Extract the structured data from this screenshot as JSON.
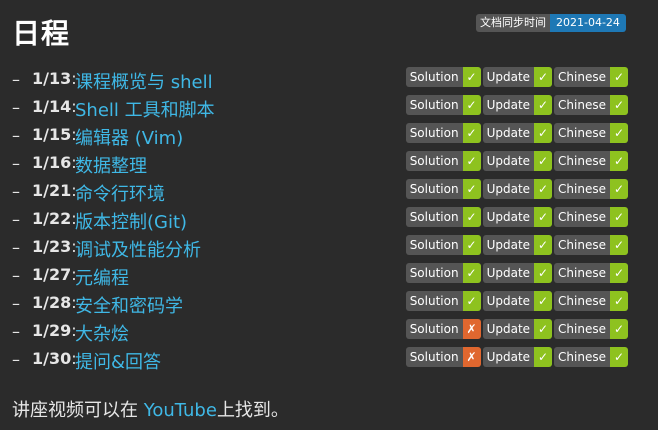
{
  "page": {
    "title": "日程",
    "sync_label": "文档同步时间",
    "sync_date": "2021-04-24"
  },
  "dash": "–",
  "colon": ":",
  "schedule": [
    {
      "date": "1/13",
      "topic": "课程概览与 shell",
      "badges": [
        {
          "label": "Solution",
          "mark": "✓",
          "ok": true
        },
        {
          "label": "Update",
          "mark": "✓",
          "ok": true
        },
        {
          "label": "Chinese",
          "mark": "✓",
          "ok": true
        }
      ]
    },
    {
      "date": "1/14",
      "topic": "Shell 工具和脚本",
      "badges": [
        {
          "label": "Solution",
          "mark": "✓",
          "ok": true
        },
        {
          "label": "Update",
          "mark": "✓",
          "ok": true
        },
        {
          "label": "Chinese",
          "mark": "✓",
          "ok": true
        }
      ]
    },
    {
      "date": "1/15",
      "topic": "编辑器 (Vim)",
      "badges": [
        {
          "label": "Solution",
          "mark": "✓",
          "ok": true
        },
        {
          "label": "Update",
          "mark": "✓",
          "ok": true
        },
        {
          "label": "Chinese",
          "mark": "✓",
          "ok": true
        }
      ]
    },
    {
      "date": "1/16",
      "topic": "数据整理",
      "badges": [
        {
          "label": "Solution",
          "mark": "✓",
          "ok": true
        },
        {
          "label": "Update",
          "mark": "✓",
          "ok": true
        },
        {
          "label": "Chinese",
          "mark": "✓",
          "ok": true
        }
      ]
    },
    {
      "date": "1/21",
      "topic": "命令行环境",
      "badges": [
        {
          "label": "Solution",
          "mark": "✓",
          "ok": true
        },
        {
          "label": "Update",
          "mark": "✓",
          "ok": true
        },
        {
          "label": "Chinese",
          "mark": "✓",
          "ok": true
        }
      ]
    },
    {
      "date": "1/22",
      "topic": "版本控制(Git)",
      "badges": [
        {
          "label": "Solution",
          "mark": "✓",
          "ok": true
        },
        {
          "label": "Update",
          "mark": "✓",
          "ok": true
        },
        {
          "label": "Chinese",
          "mark": "✓",
          "ok": true
        }
      ]
    },
    {
      "date": "1/23",
      "topic": "调试及性能分析",
      "badges": [
        {
          "label": "Solution",
          "mark": "✓",
          "ok": true
        },
        {
          "label": "Update",
          "mark": "✓",
          "ok": true
        },
        {
          "label": "Chinese",
          "mark": "✓",
          "ok": true
        }
      ]
    },
    {
      "date": "1/27",
      "topic": "元编程",
      "badges": [
        {
          "label": "Solution",
          "mark": "✓",
          "ok": true
        },
        {
          "label": "Update",
          "mark": "✓",
          "ok": true
        },
        {
          "label": "Chinese",
          "mark": "✓",
          "ok": true
        }
      ]
    },
    {
      "date": "1/28",
      "topic": "安全和密码学",
      "badges": [
        {
          "label": "Solution",
          "mark": "✓",
          "ok": true
        },
        {
          "label": "Update",
          "mark": "✓",
          "ok": true
        },
        {
          "label": "Chinese",
          "mark": "✓",
          "ok": true
        }
      ]
    },
    {
      "date": "1/29",
      "topic": "大杂烩",
      "badges": [
        {
          "label": "Solution",
          "mark": "✗",
          "ok": false
        },
        {
          "label": "Update",
          "mark": "✓",
          "ok": true
        },
        {
          "label": "Chinese",
          "mark": "✓",
          "ok": true
        }
      ]
    },
    {
      "date": "1/30",
      "topic": "提问&回答",
      "badges": [
        {
          "label": "Solution",
          "mark": "✗",
          "ok": false
        },
        {
          "label": "Update",
          "mark": "✓",
          "ok": true
        },
        {
          "label": "Chinese",
          "mark": "✓",
          "ok": true
        }
      ]
    }
  ],
  "footer": {
    "before": "讲座视频可以在 ",
    "link": "YouTube",
    "after": "上找到。"
  },
  "colors": {
    "background": "#2b2b2b",
    "link": "#3fb8e6",
    "badge_ok": "#8ec21f",
    "badge_no": "#e0672f",
    "badge_label": "#555555",
    "sync_value": "#1e78b5"
  }
}
